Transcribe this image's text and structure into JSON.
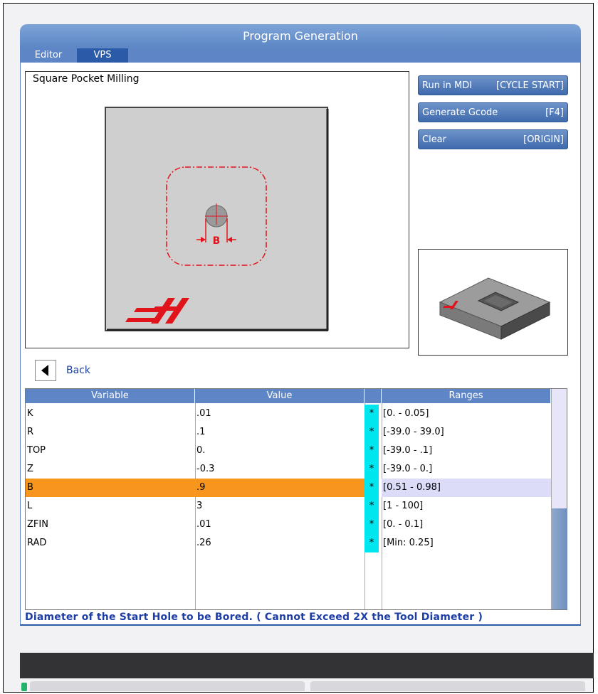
{
  "window": {
    "title": "Program Generation"
  },
  "tabs": [
    {
      "label": "Editor"
    },
    {
      "label": "VPS"
    }
  ],
  "group": {
    "title": "Square Pocket Milling"
  },
  "diagram": {
    "dimension_label": "B"
  },
  "actions": [
    {
      "label": "Run in MDI",
      "key": "[CYCLE START]"
    },
    {
      "label": "Generate Gcode",
      "key": "[F4]"
    },
    {
      "label": "Clear",
      "key": "[ORIGIN]"
    }
  ],
  "back": {
    "label": "Back"
  },
  "table": {
    "headers": {
      "variable": "Variable",
      "value": "Value",
      "ranges": "Ranges"
    },
    "rows": [
      {
        "variable": "K",
        "value": ".01",
        "marker": "*",
        "range": "[0. - 0.05]"
      },
      {
        "variable": "R",
        "value": ".1",
        "marker": "*",
        "range": "[-39.0 - 39.0]"
      },
      {
        "variable": "TOP",
        "value": "0.",
        "marker": "*",
        "range": "[-39.0 - .1]"
      },
      {
        "variable": "Z",
        "value": "-0.3",
        "marker": "*",
        "range": "[-39.0 - 0.]"
      },
      {
        "variable": "B",
        "value": ".9",
        "marker": "*",
        "range": "[0.51 - 0.98]",
        "selected": true
      },
      {
        "variable": "L",
        "value": "3",
        "marker": "*",
        "range": "[1 - 100]"
      },
      {
        "variable": "ZFIN",
        "value": ".01",
        "marker": "*",
        "range": "[0. - 0.1]"
      },
      {
        "variable": "RAD",
        "value": ".26",
        "marker": "*",
        "range": "[Min: 0.25]"
      }
    ]
  },
  "help_text": "Diameter of the Start Hole to be Bored. ( Cannot Exceed 2X the Tool Diameter )",
  "colors": {
    "accent": "#5e86c6",
    "selected_row": "#f7951d",
    "marker": "#00e6ef",
    "diagram_red": "#e2141b"
  }
}
